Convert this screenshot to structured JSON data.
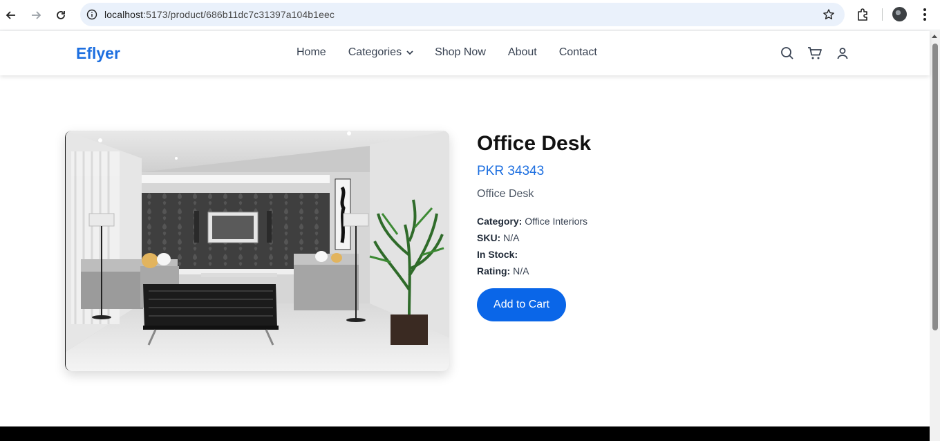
{
  "browser": {
    "url_host": "localhost",
    "url_path": ":5173/product/686b11dc7c31397a104b1eec"
  },
  "header": {
    "logo": "Eflyer",
    "nav": {
      "home": "Home",
      "categories": "Categories",
      "shop_now": "Shop Now",
      "about": "About",
      "contact": "Contact"
    },
    "icons": [
      "search-icon",
      "cart-icon",
      "user-icon"
    ]
  },
  "product": {
    "title": "Office Desk",
    "price": "PKR 34343",
    "description": "Office Desk",
    "category_label": "Category:",
    "category_value": "Office Interiors",
    "sku_label": "SKU:",
    "sku_value": "N/A",
    "stock_label": "In Stock:",
    "stock_value": "",
    "rating_label": "Rating:",
    "rating_value": "N/A",
    "add_to_cart": "Add to Cart"
  },
  "colors": {
    "brand": "#1d6fe0",
    "button": "#0a66e8"
  }
}
